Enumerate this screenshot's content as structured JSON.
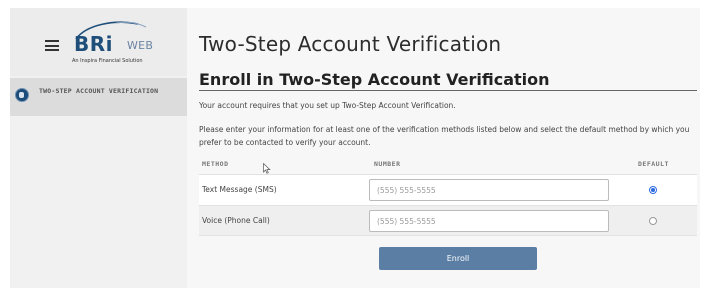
{
  "colors": {
    "brand": "#1e4e79",
    "button": "#5b7ea5",
    "radio_selected": "#2f6de0"
  },
  "header": {
    "menu_icon": "hamburger-menu-icon",
    "logo": {
      "brand": "BRi",
      "suffix": "WEB",
      "tagline": "An Inspira Financial Solution"
    }
  },
  "sidebar": {
    "items": [
      {
        "label": "TWO-STEP ACCOUNT VERIFICATION",
        "icon": "shield-lock-icon",
        "active": true
      }
    ]
  },
  "main": {
    "page_title": "Two-Step Account Verification",
    "section_title": "Enroll in Two-Step Account Verification",
    "intro": "Your account requires that you set up Two-Step Account Verification.",
    "instructions": "Please enter your information for at least one of the verification methods listed below and select the default method by which you prefer to be contacted to verify your account.",
    "table": {
      "headers": {
        "method": "METHOD",
        "number": "NUMBER",
        "default": "DEFAULT"
      },
      "rows": [
        {
          "method": "Text Message (SMS)",
          "value": "",
          "placeholder": "(555) 555-5555",
          "default": true
        },
        {
          "method": "Voice (Phone Call)",
          "value": "",
          "placeholder": "(555) 555-5555",
          "default": false
        }
      ]
    },
    "submit_label": "Enroll"
  }
}
